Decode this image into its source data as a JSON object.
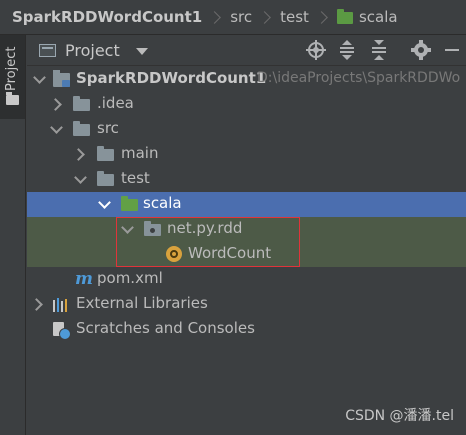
{
  "breadcrumb": {
    "project": "SparkRDDWordCount1",
    "items": [
      "src",
      "test"
    ],
    "current": "scala"
  },
  "left_strip": {
    "tab_label": "Project"
  },
  "panel": {
    "title": "Project"
  },
  "tree": {
    "root_name": "SparkRDDWordCount1",
    "root_path": "D:\\ideaProjects\\SparkRDDWo",
    "idea": ".idea",
    "src": "src",
    "main": "main",
    "test": "test",
    "scala": "scala",
    "package": "net.py.rdd",
    "wordcount": "WordCount",
    "pom": "pom.xml",
    "external_libraries": "External Libraries",
    "scratches": "Scratches and Consoles"
  },
  "watermark": "CSDN @潘潘.tel",
  "colors": {
    "selection": "#4b6eaf",
    "highlight_row": "#4d5a47",
    "source_folder_green": "#62a046",
    "annotation_box": "#e0343a",
    "scala_object": "#d8a23d",
    "maven_blue": "#4e9ad8"
  },
  "icons": {
    "breadcrumb_folder": "green-folder-icon",
    "locate": "locate-icon",
    "expand_all": "expand-all-icon",
    "collapse_all": "collapse-all-icon",
    "settings": "gear-icon",
    "hide": "minimize-icon"
  }
}
